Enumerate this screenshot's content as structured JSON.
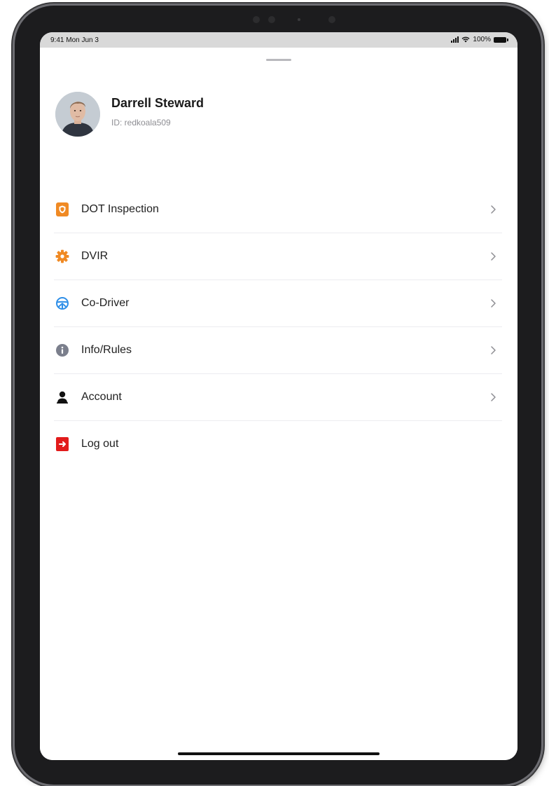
{
  "status_bar": {
    "time": "9:41 Mon Jun 3",
    "battery": "100%"
  },
  "profile": {
    "name": "Darrell Steward",
    "id_text": "ID: redkoala509"
  },
  "menu": {
    "items": [
      {
        "label": "DOT Inspection",
        "icon": "document-shield-icon",
        "color": "#F08A24",
        "chevron": true
      },
      {
        "label": "DVIR",
        "icon": "gear-icon",
        "color": "#F08A24",
        "chevron": true
      },
      {
        "label": "Co-Driver",
        "icon": "steering-wheel-icon",
        "color": "#2F8FE8",
        "chevron": true
      },
      {
        "label": "Info/Rules",
        "icon": "info-icon",
        "color": "#7B7F8C",
        "chevron": true
      },
      {
        "label": "Account",
        "icon": "person-icon",
        "color": "#111111",
        "chevron": true
      },
      {
        "label": "Log out",
        "icon": "logout-icon",
        "color": "#E21B1B",
        "chevron": false
      }
    ]
  }
}
